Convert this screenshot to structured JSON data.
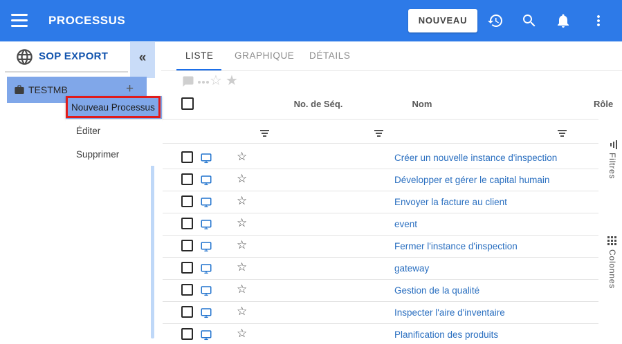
{
  "header": {
    "title": "PROCESSUS",
    "new_button_label": "NOUVEAU"
  },
  "sidebar": {
    "workspace_name": "SOP EXPORT",
    "collapse_glyph": "«",
    "tree_item": {
      "label": "TESTMB",
      "add_glyph": "+"
    },
    "context_menu": {
      "items": [
        "Nouveau Processus",
        "Éditer",
        "Supprimer"
      ],
      "highlighted_item": "Nouveau Processus"
    }
  },
  "tabs": [
    {
      "label": "LISTE",
      "active": true
    },
    {
      "label": "GRAPHIQUE",
      "active": false
    },
    {
      "label": "DÉTAILS",
      "active": false
    }
  ],
  "toolbar": {
    "star_outline_glyph": "☆",
    "star_filled_glyph": "★"
  },
  "table": {
    "columns": [
      "No. de Séq.",
      "Nom",
      "Rôle"
    ],
    "row_star_glyph": "☆",
    "rows": [
      "Créer un nouvelle instance d'inspection",
      "Développer et gérer le capital humain",
      "Envoyer la facture au client",
      "event",
      "Fermer l'instance d'inspection",
      "gateway",
      "Gestion de la qualité",
      "Inspecter l'aire d'inventaire",
      "Planification des produits"
    ]
  },
  "side_rail": {
    "filters_label": "Filtres",
    "columns_label": "Colonnes"
  },
  "colors": {
    "appbar_blue": "#2D7AE8",
    "selection_blue": "#80A7E9",
    "link_blue": "#2A6FC0",
    "tab_underline_blue": "#1D6FE8",
    "workspace_text_blue": "#1254AE",
    "annotation_red": "#E01B1B"
  }
}
